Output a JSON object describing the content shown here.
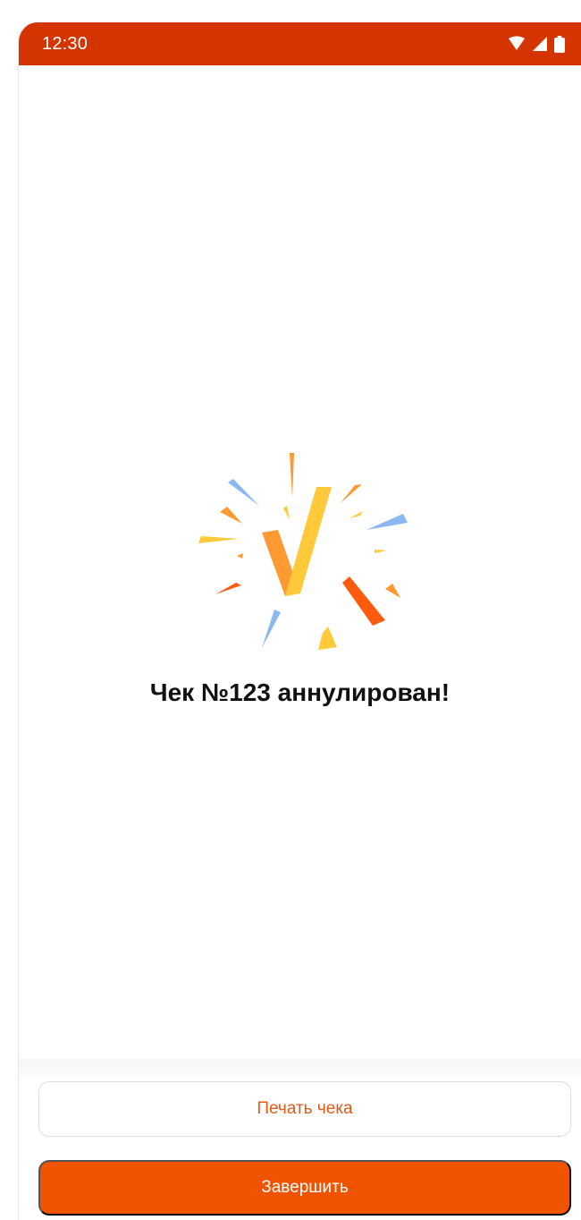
{
  "status_bar": {
    "time": "12:30",
    "icons": [
      "wifi-icon",
      "cellular-signal-icon",
      "battery-icon"
    ]
  },
  "result": {
    "message": "Чек №123 аннулирован!",
    "icon": "check-confetti-icon"
  },
  "actions": {
    "print_label": "Печать чека",
    "finish_label": "Завершить"
  },
  "colors": {
    "status_bar": "#d43500",
    "accent": "#f05400",
    "secondary_text": "#e05a17",
    "confetti_orange": "#ff9932",
    "confetti_yellow": "#ffc93a",
    "confetti_blue": "#8bb8f0",
    "confetti_red_orange": "#ff5a0d"
  }
}
